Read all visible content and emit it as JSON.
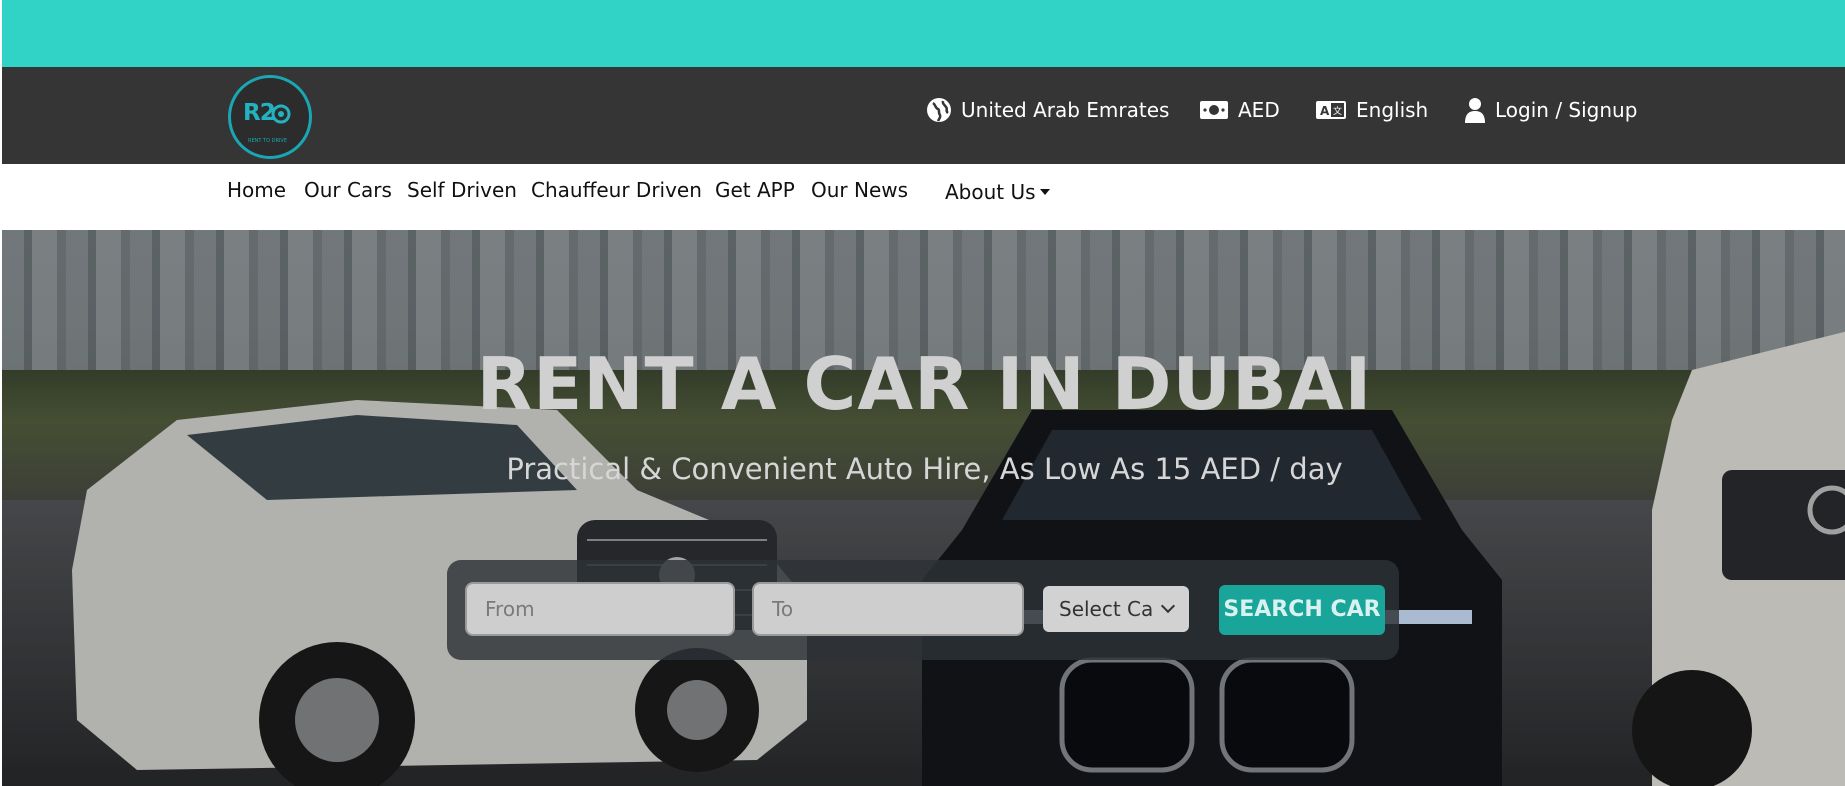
{
  "colors": {
    "topbar": "#31d3c7",
    "header": "#353535",
    "accent": "#1aa59b"
  },
  "logo": {
    "mark": "R2",
    "tagline": "RENT TO DRIVE"
  },
  "header": {
    "country": {
      "icon": "globe-icon",
      "label": "United Arab Emrates"
    },
    "currency": {
      "icon": "money-icon",
      "label": "AED"
    },
    "language": {
      "icon": "translate-icon",
      "label": "English"
    },
    "account": {
      "icon": "user-icon",
      "label": "Login / Signup"
    }
  },
  "nav": {
    "items": [
      "Home",
      "Our Cars",
      "Self Driven",
      "Chauffeur Driven",
      "Get APP",
      "Our News"
    ],
    "about": "About Us"
  },
  "hero": {
    "title": "RENT A CAR IN DUBAI",
    "subtitle": "Practical & Convenient Auto Hire, As Low As 15 AED / day"
  },
  "search": {
    "from_placeholder": "From",
    "to_placeholder": "To",
    "select_value": "Select Ca",
    "button": "SEARCH CAR"
  }
}
